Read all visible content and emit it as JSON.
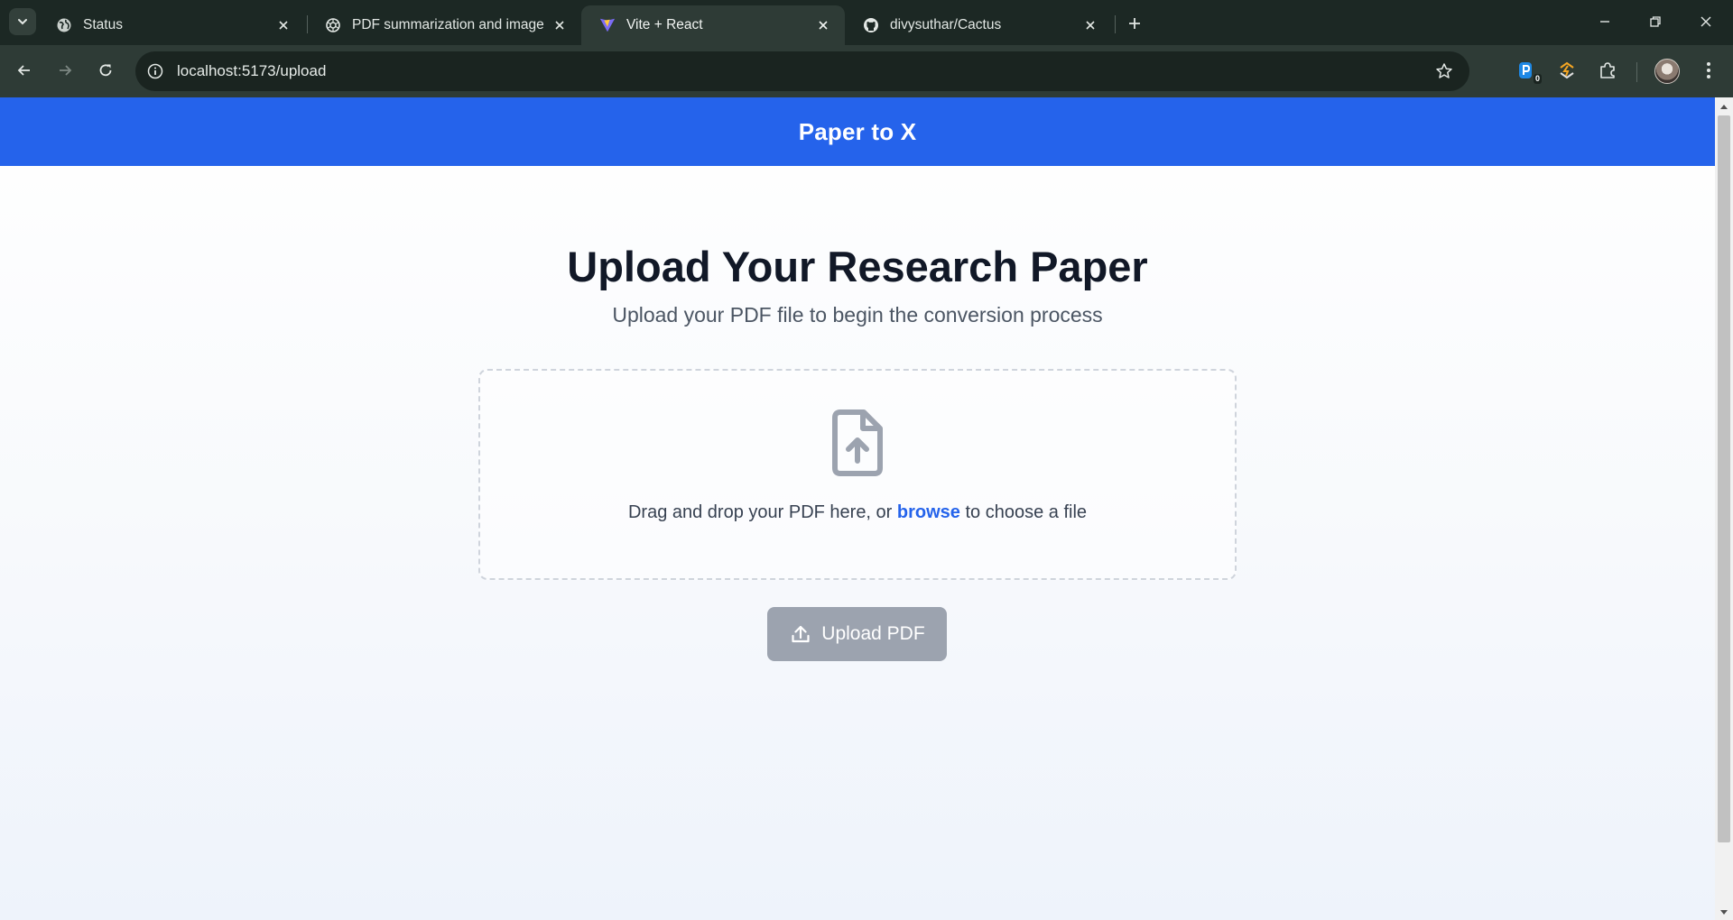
{
  "browser": {
    "tabs": [
      {
        "title": "Status",
        "icon": "globe-icon",
        "active": false
      },
      {
        "title": "PDF summarization and image",
        "icon": "openai-icon",
        "active": false
      },
      {
        "title": "Vite + React",
        "icon": "vite-icon",
        "active": true
      },
      {
        "title": "divysuthar/Cactus",
        "icon": "github-icon",
        "active": false
      }
    ],
    "url": "localhost:5173/upload",
    "extension_badge": "0"
  },
  "app": {
    "header_title": "Paper to X"
  },
  "upload": {
    "heading": "Upload Your Research Paper",
    "subheading": "Upload your PDF file to begin the conversion process",
    "drop_text_before": "Drag and drop your PDF here, or",
    "browse_link": "browse",
    "drop_text_after": "to choose a file",
    "button_label": "Upload PDF",
    "button_color": "#9ca3af",
    "accent_color": "#2563eb"
  }
}
